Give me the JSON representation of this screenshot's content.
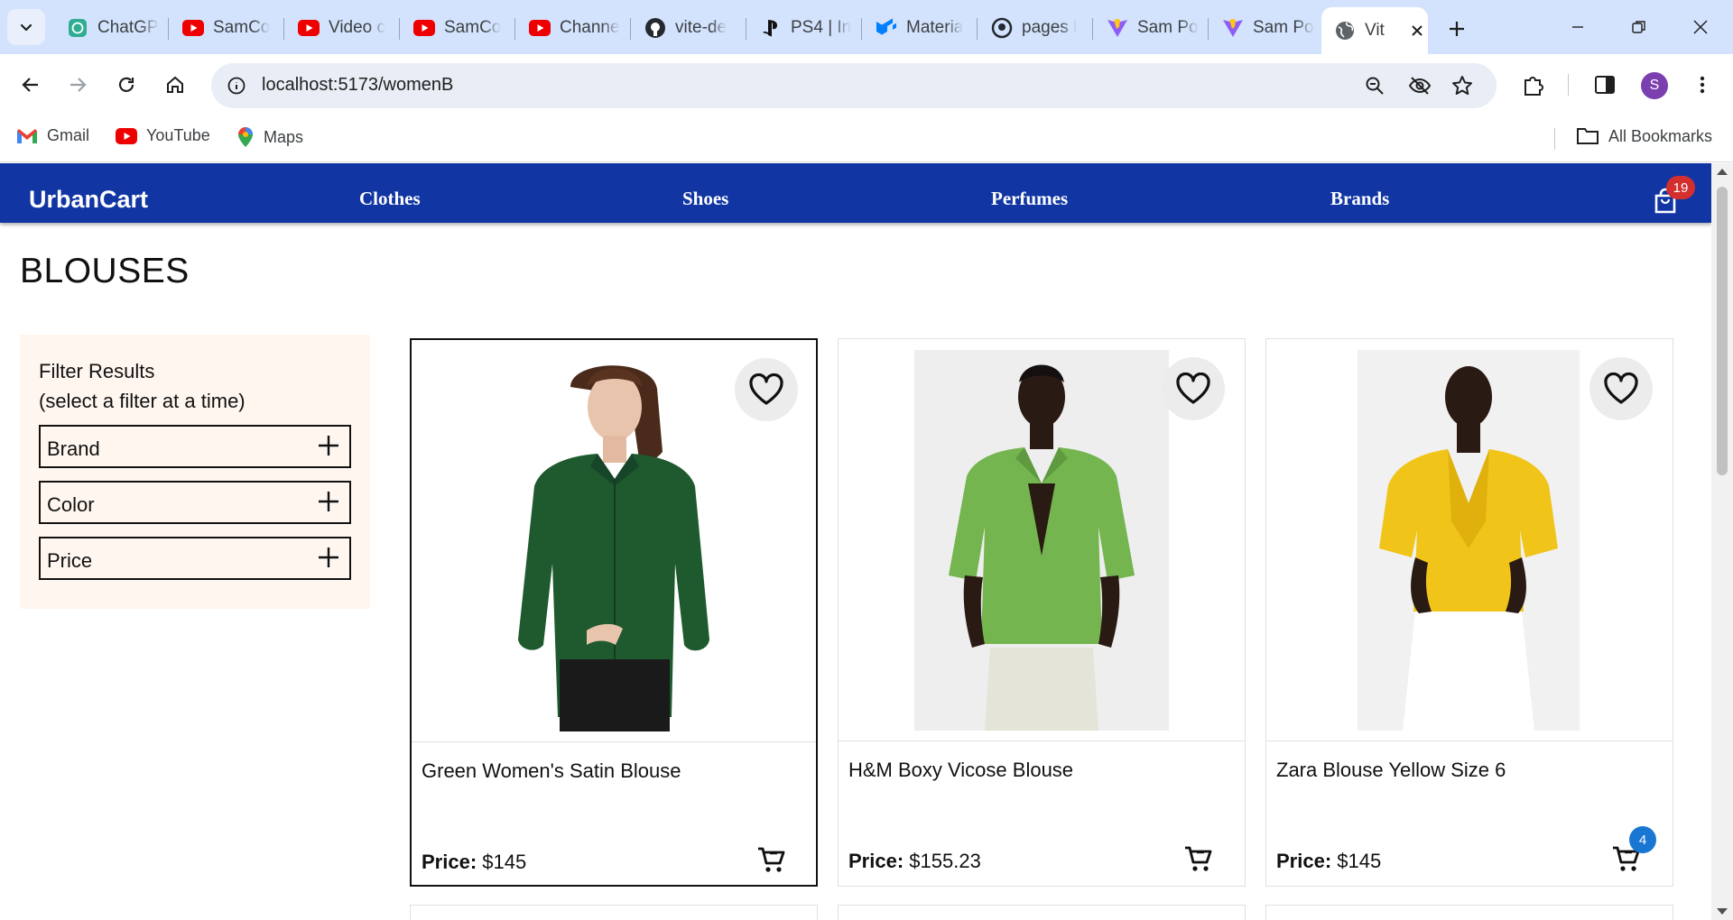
{
  "browser": {
    "tabs": [
      {
        "label": "ChatGP",
        "icon": "chatgpt-icon"
      },
      {
        "label": "SamCo",
        "icon": "youtube-icon"
      },
      {
        "label": "Video c",
        "icon": "youtube-icon"
      },
      {
        "label": "SamCo",
        "icon": "youtube-icon"
      },
      {
        "label": "Channe",
        "icon": "youtube-icon"
      },
      {
        "label": "vite-de",
        "icon": "github-icon"
      },
      {
        "label": "PS4 | In",
        "icon": "playstation-icon"
      },
      {
        "label": "Materia",
        "icon": "mui-icon"
      },
      {
        "label": "pages l",
        "icon": "github-pages-icon"
      },
      {
        "label": "Sam Po",
        "icon": "vite-icon"
      },
      {
        "label": "Sam Po",
        "icon": "vite-icon"
      },
      {
        "label": "Vit",
        "icon": "globe-icon",
        "active": true
      }
    ],
    "url": "localhost:5173/womenB",
    "bookmarks": [
      {
        "label": "Gmail",
        "icon": "gmail-icon"
      },
      {
        "label": "YouTube",
        "icon": "youtube-icon"
      },
      {
        "label": "Maps",
        "icon": "maps-icon"
      }
    ],
    "all_bookmarks_label": "All Bookmarks",
    "profile_initial": "S"
  },
  "app": {
    "brand": "UrbanCart",
    "nav": [
      "Clothes",
      "Shoes",
      "Perfumes",
      "Brands"
    ],
    "cart_count": "19",
    "colors": {
      "appbar": "#1136a3",
      "cart_badge": "#d32f2f",
      "item_badge": "#1976d2",
      "filter_bg": "#fff6f0"
    }
  },
  "page": {
    "title": "BLOUSES",
    "filter": {
      "heading_line1": "Filter Results",
      "heading_line2": "(select a filter at a time)",
      "options": [
        "Brand",
        "Color",
        "Price"
      ]
    },
    "price_label": "Price:",
    "products": [
      {
        "name": "Green Women's Satin Blouse",
        "price": "$145",
        "image": "green satin blouse photo",
        "selected": true
      },
      {
        "name": "H&M Boxy Vicose Blouse",
        "price": "$155.23",
        "image": "light green blouse photo"
      },
      {
        "name": "Zara Blouse Yellow Size 6",
        "price": "$145",
        "image": "yellow blouse photo",
        "cart_badge": "4"
      }
    ]
  }
}
